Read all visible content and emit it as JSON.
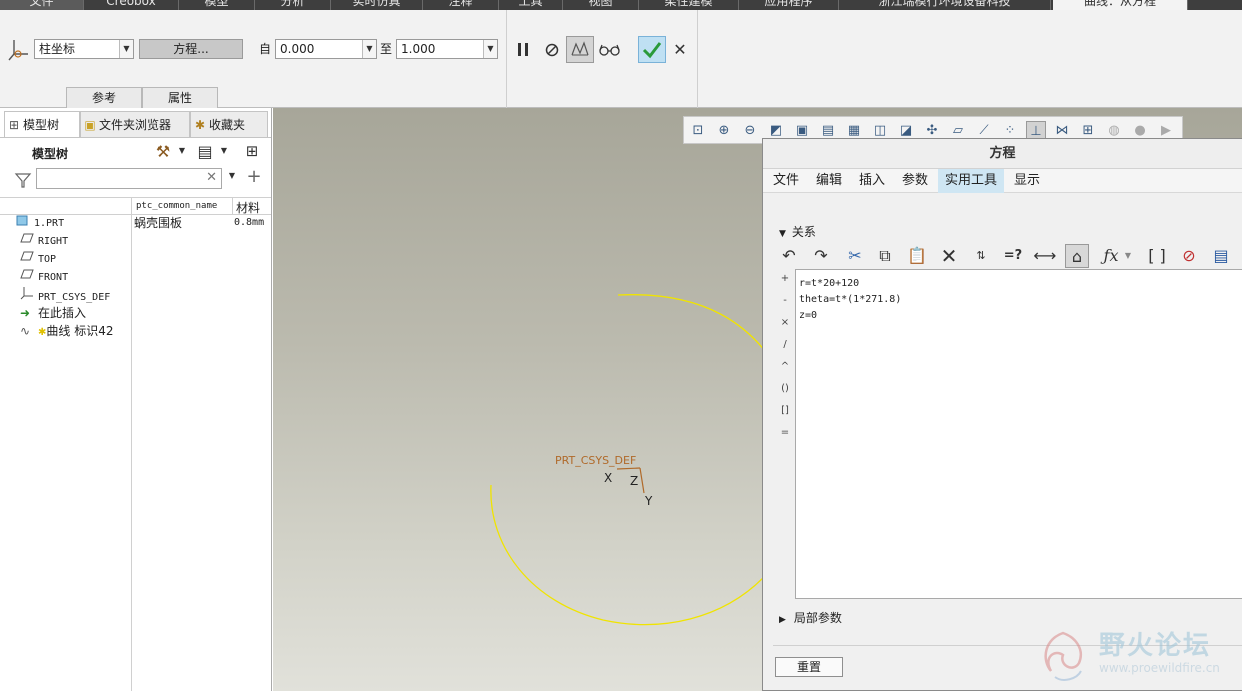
{
  "ribbon": {
    "tabs": [
      "文件",
      "Creobox",
      "模型",
      "分析",
      "实时仿真",
      "注释",
      "工具",
      "视图",
      "柔性建模",
      "应用程序",
      "浙江瑞模行环境设备科技",
      "曲线：从方程"
    ],
    "active_tab_index": 11,
    "coord_type": "柱坐标",
    "equation_button": "方程...",
    "from_label": "自",
    "from_value": "0.000",
    "to_label": "至",
    "to_value": "1.000",
    "subtabs": [
      "参考",
      "属性"
    ]
  },
  "model_panel": {
    "tabs": [
      "模型树",
      "文件夹浏览器",
      "收藏夹"
    ],
    "title": "模型树",
    "filter_placeholder": "",
    "columns": [
      "",
      "ptc_common_name",
      "材料"
    ],
    "rows": [
      {
        "icon": "part-icon",
        "name": "1.PRT",
        "common_name": "蜗壳围板",
        "material": "0.8mm"
      },
      {
        "icon": "datum-plane-icon",
        "name": "RIGHT",
        "common_name": "",
        "material": ""
      },
      {
        "icon": "datum-plane-icon",
        "name": "TOP",
        "common_name": "",
        "material": ""
      },
      {
        "icon": "datum-plane-icon",
        "name": "FRONT",
        "common_name": "",
        "material": ""
      },
      {
        "icon": "csys-icon",
        "name": "PRT_CSYS_DEF",
        "common_name": "",
        "material": ""
      },
      {
        "icon": "insert-here-icon",
        "name": "在此插入",
        "common_name": "",
        "material": ""
      },
      {
        "icon": "curve-icon",
        "name": "曲线 标识42",
        "common_name": "",
        "material": ""
      }
    ]
  },
  "graphics": {
    "csys_label": "PRT_CSYS_DEF",
    "axes": {
      "x": "X",
      "y": "Y",
      "z": "Z"
    },
    "curve_color": "#f0e400",
    "csys_color": "#b06a2a"
  },
  "dialog": {
    "title": "方程",
    "menu": [
      "文件",
      "编辑",
      "插入",
      "参数",
      "实用工具",
      "显示"
    ],
    "active_menu_index": 4,
    "section_label": "关系",
    "operators": [
      "+",
      "-",
      "×",
      "/",
      "^",
      "()",
      "[]",
      "="
    ],
    "equations": [
      "r=t*20+120",
      "theta=t*(1*271.8)",
      "z=0"
    ],
    "local_params_label": "局部参数",
    "reset_button": "重置"
  },
  "watermark": {
    "title": "野火论坛",
    "url": "www.proewildfire.cn"
  }
}
